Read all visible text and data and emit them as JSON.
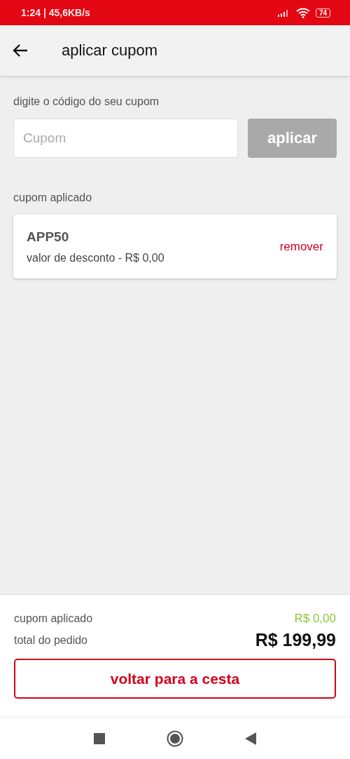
{
  "status_bar": {
    "time": "1:24",
    "separator": "|",
    "speed": "45,6KB/s",
    "battery": "74"
  },
  "header": {
    "title": "aplicar cupom"
  },
  "coupon_form": {
    "label": "digite o código do seu cupom",
    "placeholder": "Cupom",
    "apply_button": {
      "label": "aplicar",
      "disabled": true
    }
  },
  "applied_section": {
    "label": "cupom aplicado",
    "coupons": [
      {
        "code": "APP50",
        "discount": "valor de desconto - R$ 0,00",
        "remove": "remover"
      }
    ]
  },
  "summary": {
    "rows": [
      {
        "label": "cupom aplicado",
        "value": "R$ 0,00",
        "kind": "discount"
      },
      {
        "label": "total do pedido",
        "value": "R$ 199,99",
        "kind": "total"
      }
    ],
    "button": "voltar para a cesta"
  }
}
